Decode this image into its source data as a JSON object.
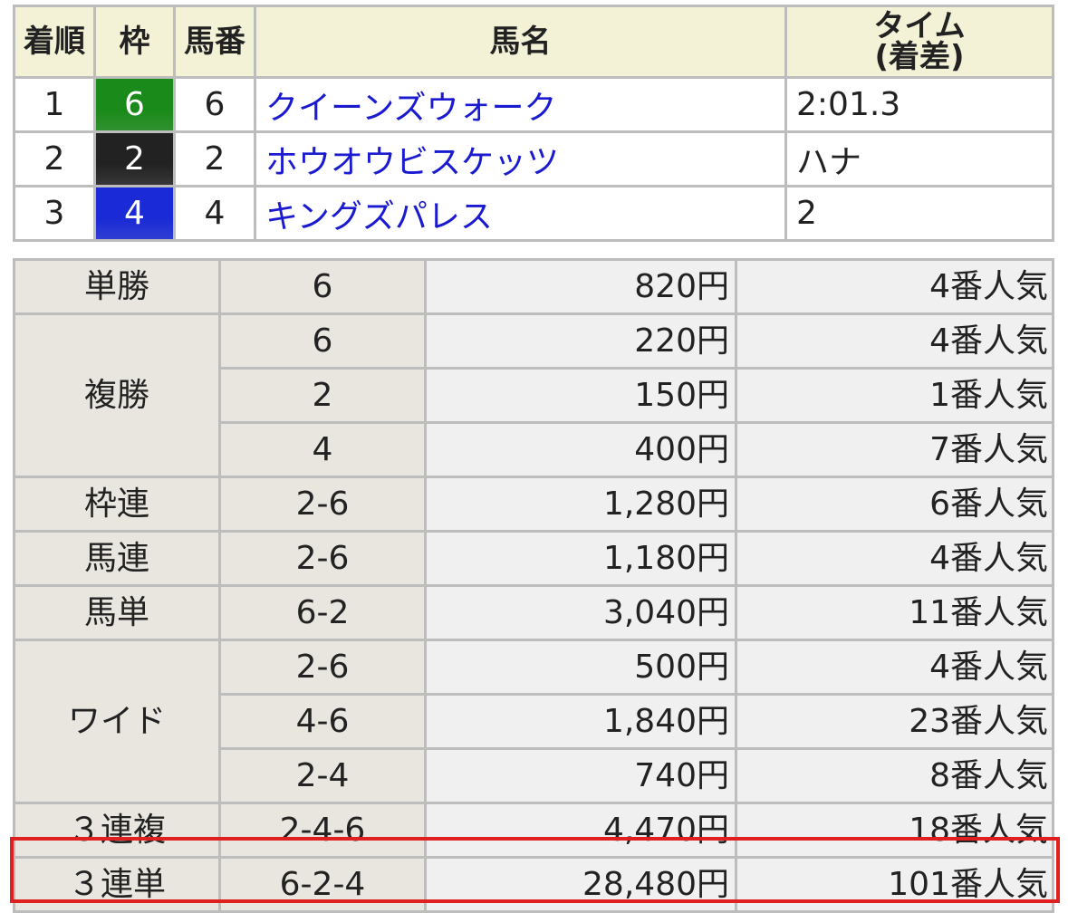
{
  "results": {
    "headers": {
      "rank": "着順",
      "waku": "枠",
      "umaban": "馬番",
      "horse": "馬名",
      "time_line1": "タイム",
      "time_line2": "(着差)"
    },
    "rows": [
      {
        "rank": "1",
        "waku": "6",
        "waku_color": "#1a8a1a",
        "umaban": "6",
        "horse": "クイーンズウォーク",
        "time": "2:01.3"
      },
      {
        "rank": "2",
        "waku": "2",
        "waku_color": "#222222",
        "umaban": "2",
        "horse": "ホウオウビスケッツ",
        "time": "ハナ"
      },
      {
        "rank": "3",
        "waku": "4",
        "waku_color": "#1a2ad6",
        "umaban": "4",
        "horse": "キングズパレス",
        "time": "2"
      }
    ]
  },
  "payouts": [
    {
      "kind": "単勝",
      "entries": [
        {
          "combo": "6",
          "amount": "820円",
          "popularity": "4番人気"
        }
      ]
    },
    {
      "kind": "複勝",
      "entries": [
        {
          "combo": "6",
          "amount": "220円",
          "popularity": "4番人気"
        },
        {
          "combo": "2",
          "amount": "150円",
          "popularity": "1番人気"
        },
        {
          "combo": "4",
          "amount": "400円",
          "popularity": "7番人気"
        }
      ]
    },
    {
      "kind": "枠連",
      "entries": [
        {
          "combo": "2-6",
          "amount": "1,280円",
          "popularity": "6番人気"
        }
      ]
    },
    {
      "kind": "馬連",
      "entries": [
        {
          "combo": "2-6",
          "amount": "1,180円",
          "popularity": "4番人気"
        }
      ]
    },
    {
      "kind": "馬単",
      "entries": [
        {
          "combo": "6-2",
          "amount": "3,040円",
          "popularity": "11番人気"
        }
      ]
    },
    {
      "kind": "ワイド",
      "entries": [
        {
          "combo": "2-6",
          "amount": "500円",
          "popularity": "4番人気"
        },
        {
          "combo": "4-6",
          "amount": "1,840円",
          "popularity": "23番人気"
        },
        {
          "combo": "2-4",
          "amount": "740円",
          "popularity": "8番人気"
        }
      ]
    },
    {
      "kind": "３連複",
      "entries": [
        {
          "combo": "2-4-6",
          "amount": "4,470円",
          "popularity": "18番人気"
        }
      ]
    },
    {
      "kind": "３連単",
      "entries": [
        {
          "combo": "6-2-4",
          "amount": "28,480円",
          "popularity": "101番人気"
        }
      ]
    }
  ],
  "colors": {
    "highlight": "#e02020",
    "horse_link": "#1a1ad0",
    "header_bg": "#f4f2d6"
  }
}
